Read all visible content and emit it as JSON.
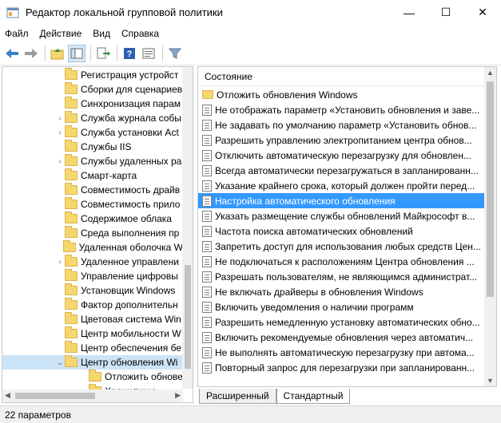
{
  "window": {
    "title": "Редактор локальной групповой политики",
    "controls": {
      "minimize": "—",
      "maximize": "☐",
      "close": "✕"
    }
  },
  "menu": [
    "Файл",
    "Действие",
    "Вид",
    "Справка"
  ],
  "toolbar_icons": [
    "back-icon",
    "forward-icon",
    "up-folder-icon",
    "show-tree-icon",
    "export-icon",
    "help-icon",
    "properties-icon",
    "filter-icon"
  ],
  "tree": {
    "items": [
      {
        "label": "Регистрация устройст",
        "arrow": ""
      },
      {
        "label": "Сборки для сценариев",
        "arrow": ""
      },
      {
        "label": "Синхронизация парам",
        "arrow": ""
      },
      {
        "label": "Служба журнала собы",
        "arrow": "›"
      },
      {
        "label": "Служба установки Act",
        "arrow": "›"
      },
      {
        "label": "Службы IIS",
        "arrow": ""
      },
      {
        "label": "Службы удаленных ра",
        "arrow": "›"
      },
      {
        "label": "Смарт-карта",
        "arrow": ""
      },
      {
        "label": "Совместимость драйв",
        "arrow": ""
      },
      {
        "label": "Совместимость прило",
        "arrow": ""
      },
      {
        "label": "Содержимое облака",
        "arrow": ""
      },
      {
        "label": "Среда выполнения пр",
        "arrow": ""
      },
      {
        "label": "Удаленная оболочка W",
        "arrow": ""
      },
      {
        "label": "Удаленное управлени",
        "arrow": "›"
      },
      {
        "label": "Управление цифровы",
        "arrow": ""
      },
      {
        "label": "Установщик Windows",
        "arrow": ""
      },
      {
        "label": "Фактор дополнительн",
        "arrow": ""
      },
      {
        "label": "Цветовая система Win",
        "arrow": ""
      },
      {
        "label": "Центр мобильности W",
        "arrow": ""
      },
      {
        "label": "Центр обеспечения бе",
        "arrow": ""
      },
      {
        "label": "Центр обновления Wi",
        "arrow": "⌄"
      },
      {
        "label": "Отложить обнове",
        "arrow": ""
      },
      {
        "label": "Хранилище",
        "arrow": ""
      }
    ],
    "selected_index": 20
  },
  "list": {
    "header": "Состояние",
    "items": [
      {
        "label": "Отложить обновления Windows",
        "type": "folder"
      },
      {
        "label": "Не отображать параметр «Установить обновления и заве...",
        "type": "setting"
      },
      {
        "label": "Не задавать по умолчанию параметр «Установить обнов...",
        "type": "setting"
      },
      {
        "label": "Разрешить управлению электропитанием центра обнов...",
        "type": "setting"
      },
      {
        "label": "Отключить автоматическую перезагрузку для обновлен...",
        "type": "setting"
      },
      {
        "label": "Всегда автоматически перезагружаться в запланированн...",
        "type": "setting"
      },
      {
        "label": "Указание крайнего срока, который должен пройти перед...",
        "type": "setting"
      },
      {
        "label": "Настройка автоматического обновления",
        "type": "setting"
      },
      {
        "label": "Указать размещение службы обновлений Майкрософт в...",
        "type": "setting"
      },
      {
        "label": "Частота поиска автоматических обновлений",
        "type": "setting"
      },
      {
        "label": "Запретить доступ для использования любых средств Цен...",
        "type": "setting"
      },
      {
        "label": "Не подключаться к расположениям Центра обновления ...",
        "type": "setting"
      },
      {
        "label": "Разрешать пользователям, не являющимся администрат...",
        "type": "setting"
      },
      {
        "label": "Не включать драйверы в обновления Windows",
        "type": "setting"
      },
      {
        "label": "Включить уведомления о наличии программ",
        "type": "setting"
      },
      {
        "label": "Разрешить немедленную установку автоматических обно...",
        "type": "setting"
      },
      {
        "label": "Включить рекомендуемые обновления через автоматич...",
        "type": "setting"
      },
      {
        "label": "Не выполнять автоматическую перезагрузку при автома...",
        "type": "setting"
      },
      {
        "label": "Повторный запрос для перезагрузки при запланированн...",
        "type": "setting"
      }
    ],
    "selected_index": 7
  },
  "tabs": [
    "Расширенный",
    "Стандартный"
  ],
  "status": "22 параметров"
}
